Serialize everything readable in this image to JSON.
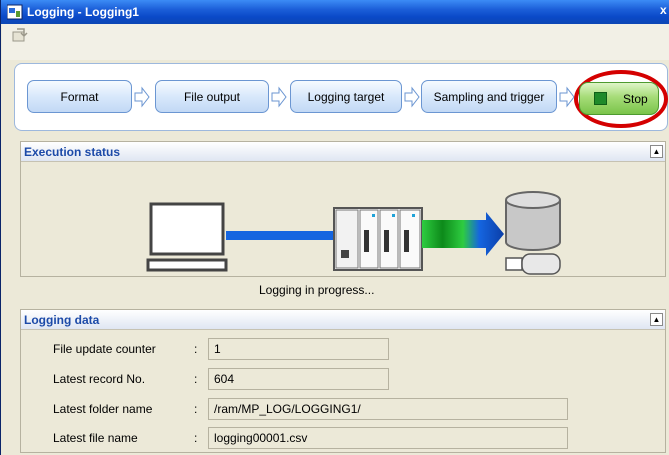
{
  "window": {
    "title": "Logging - Logging1",
    "close_glyph": "x"
  },
  "toolbar": {
    "icons": [
      "window-app-icon",
      "export-icon"
    ]
  },
  "wizard": {
    "steps": [
      {
        "label": "Format"
      },
      {
        "label": "File output"
      },
      {
        "label": "Logging target"
      },
      {
        "label": "Sampling and trigger"
      }
    ],
    "stop": {
      "label": "Stop",
      "accent": "#d40000",
      "button_color": "#7ac44a"
    }
  },
  "execution_status": {
    "title": "Execution status",
    "status_text": "Logging in progress...",
    "icons": [
      "computer-icon",
      "plc-controller-icon",
      "data-flow-arrow-icon",
      "database-icon",
      "usb-memory-icon"
    ]
  },
  "logging_data": {
    "title": "Logging data",
    "rows": [
      {
        "label": "File update counter",
        "value": "1"
      },
      {
        "label": "Latest record No.",
        "value": "604"
      },
      {
        "label": "Latest folder name",
        "value": "/ram/MP_LOG/LOGGING1/"
      },
      {
        "label": "Latest file name",
        "value": "logging00001.csv"
      }
    ]
  },
  "colors": {
    "titlebar": "#0a49c8",
    "panel_title": "#1c4aa8",
    "connection_line": "#1565e0",
    "flow_green": "#2ecc40"
  }
}
